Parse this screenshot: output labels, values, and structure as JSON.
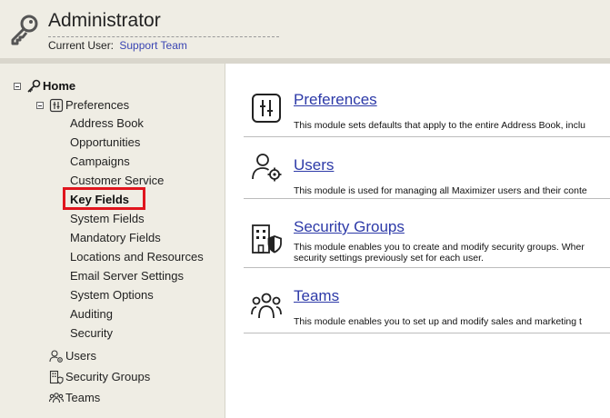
{
  "header": {
    "title": "Administrator",
    "current_user_label": "Current User:",
    "current_user_value": "Support Team"
  },
  "tree": {
    "home": "Home",
    "preferences": "Preferences",
    "preference_items": [
      "Address Book",
      "Opportunities",
      "Campaigns",
      "Customer Service",
      "Key Fields",
      "System Fields",
      "Mandatory Fields",
      "Locations and Resources",
      "Email Server Settings",
      "System Options",
      "Auditing",
      "Security"
    ],
    "active_item": "Key Fields",
    "users": "Users",
    "security_groups": "Security Groups",
    "teams": "Teams"
  },
  "modules": [
    {
      "title": "Preferences",
      "icon": "sliders-icon",
      "description_lines": [
        "This module sets defaults that apply to the entire Address Book, inclu"
      ]
    },
    {
      "title": "Users",
      "icon": "user-gear-icon",
      "description_lines": [
        "This module is used for managing all Maximizer users and their conte"
      ]
    },
    {
      "title": "Security Groups",
      "icon": "building-shield-icon",
      "description_lines": [
        "This module enables you to create and modify security groups. Wher",
        "security settings previously set for each user."
      ]
    },
    {
      "title": "Teams",
      "icon": "team-icon",
      "description_lines": [
        "This module enables you to set up and modify sales and marketing t"
      ]
    }
  ],
  "colors": {
    "background": "#efede4",
    "link": "#2d3aa8",
    "highlight": "#e0161e"
  }
}
